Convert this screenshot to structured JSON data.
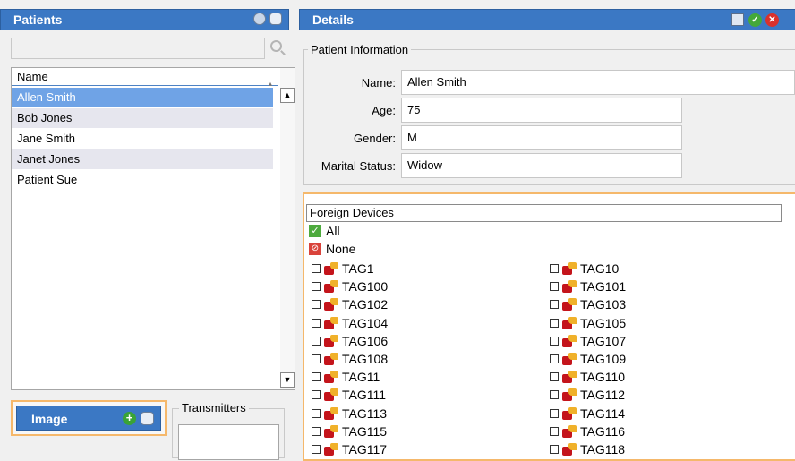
{
  "patients_panel": {
    "title": "Patients",
    "search_placeholder": "",
    "column_name": "Name",
    "rows": [
      "Allen Smith",
      "Bob Jones",
      "Jane Smith",
      "Janet Jones",
      "Patient Sue"
    ],
    "selected_row": "Allen Smith"
  },
  "image_panel": {
    "title": "Image"
  },
  "transmitters": {
    "label": "Transmitters"
  },
  "details_panel": {
    "title": "Details",
    "patient_info_legend": "Patient Information",
    "name_label": "Name:",
    "name_value": "Allen Smith",
    "age_label": "Age:",
    "age_value": "75",
    "gender_label": "Gender:",
    "gender_value": "M",
    "marital_label": "Marital Status:",
    "marital_value": "Widow"
  },
  "devices": {
    "header": "Foreign Devices",
    "all_label": "All",
    "none_label": "None",
    "col1": [
      "TAG1",
      "TAG100",
      "TAG102",
      "TAG104",
      "TAG106",
      "TAG108",
      "TAG11",
      "TAG111",
      "TAG113",
      "TAG115",
      "TAG117"
    ],
    "col2": [
      "TAG10",
      "TAG101",
      "TAG103",
      "TAG105",
      "TAG107",
      "TAG109",
      "TAG110",
      "TAG112",
      "TAG114",
      "TAG116",
      "TAG118"
    ]
  },
  "colors": {
    "header_blue": "#3b78c4",
    "selection_blue": "#6fa3e6",
    "accent_orange": "#f5b86b"
  }
}
